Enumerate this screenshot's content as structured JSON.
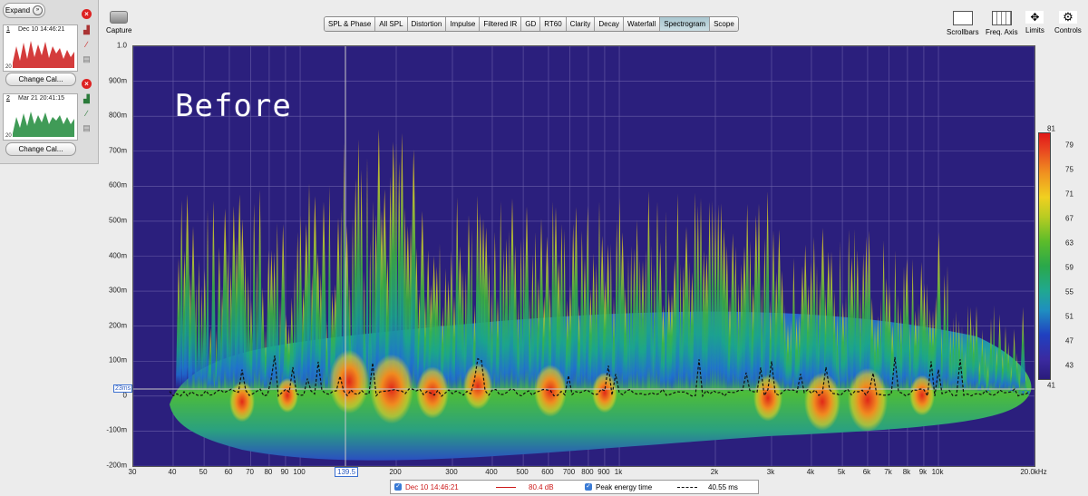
{
  "left_panel": {
    "expand_label": "Expand",
    "measurements": [
      {
        "num": "1",
        "date": "Dec 10 14:46:21",
        "lo": "20",
        "color": "#cc1a1a",
        "change_label": "Change Cal..."
      },
      {
        "num": "2",
        "date": "Mar 21 20:41:15",
        "lo": "20",
        "color": "#1f8a3a",
        "change_label": "Change Cal..."
      }
    ]
  },
  "toolbar": {
    "capture_label": "Capture",
    "tabs": [
      "SPL & Phase",
      "All SPL",
      "Distortion",
      "Impulse",
      "Filtered IR",
      "GD",
      "RT60",
      "Clarity",
      "Decay",
      "Waterfall",
      "Spectrogram",
      "Scope"
    ],
    "active_tab": "Spectrogram",
    "right_tools": [
      "Scrollbars",
      "Freq. Axis",
      "Limits",
      "Controls"
    ]
  },
  "plot": {
    "overlay_text": "Before",
    "y_labels": [
      "1.0",
      "900m",
      "800m",
      "700m",
      "600m",
      "500m",
      "400m",
      "300m",
      "200m",
      "100m",
      "0",
      "-100m",
      "-200m"
    ],
    "x_labels": [
      "30",
      "40",
      "50",
      "60",
      "70",
      "80",
      "90",
      "100",
      "200",
      "300",
      "400",
      "500",
      "600",
      "700",
      "800",
      "900",
      "1k",
      "2k",
      "3k",
      "4k",
      "5k",
      "6k",
      "7k",
      "8k",
      "9k",
      "10k",
      "20.0kHz"
    ],
    "cursor_freq": "139.5",
    "cursor_time": "23ms",
    "y_unit": "s"
  },
  "color_scale": {
    "labels": [
      "81",
      "79",
      "75",
      "71",
      "67",
      "63",
      "59",
      "55",
      "51",
      "47",
      "43",
      "41"
    ]
  },
  "legend": {
    "meas_name": "Dec 10 14:46:21",
    "meas_value": "80.4 dB",
    "meas_color": "#cc1a1a",
    "peak_label": "Peak energy time",
    "peak_value": "40.55 ms"
  }
}
